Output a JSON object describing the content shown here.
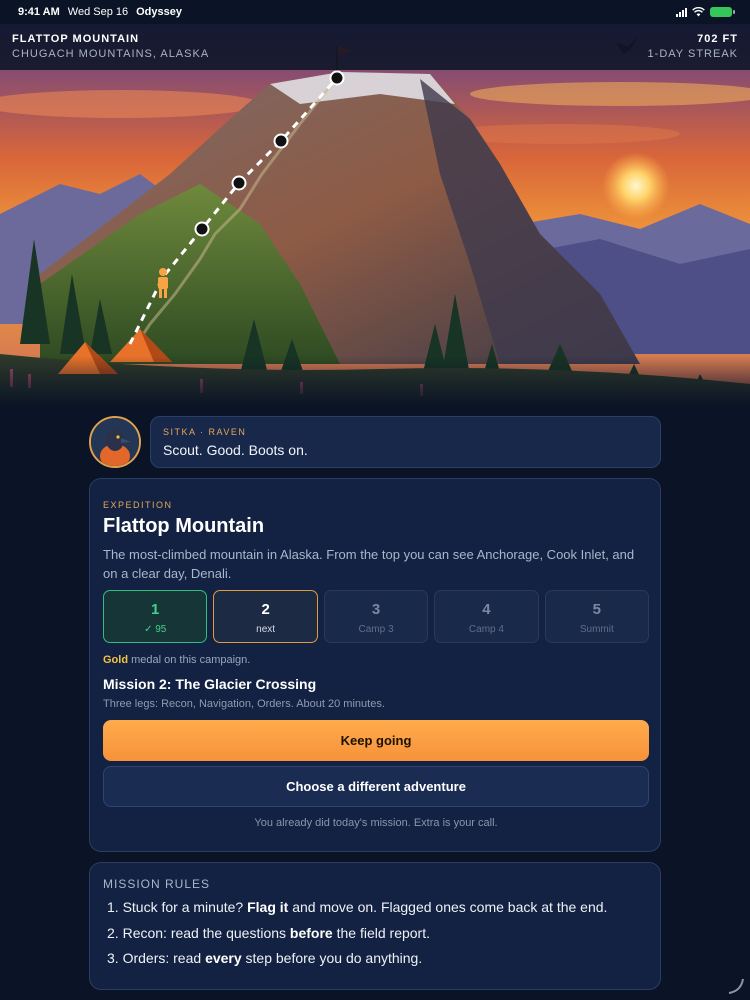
{
  "status_bar": {
    "time": "9:41 AM",
    "date": "Wed Sep 16",
    "app": "Odyssey"
  },
  "header": {
    "title": "FLATTOP MOUNTAIN",
    "subtitle": "CHUGACH MOUNTAINS, ALASKA",
    "elevation": "702 FT",
    "streak": "1-DAY STREAK"
  },
  "guide": {
    "who": "SITKA · RAVEN",
    "message": "Scout. Good. Boots on."
  },
  "expedition": {
    "eyebrow": "EXPEDITION",
    "title": "Flattop Mountain",
    "description": "The most-climbed mountain in Alaska. From the top you can see Anchorage, Cook Inlet, and on a clear day, Denali.",
    "steps": [
      {
        "num": "1",
        "sub": "✓ 95",
        "state": "done"
      },
      {
        "num": "2",
        "sub": "next",
        "state": "current"
      },
      {
        "num": "3",
        "sub": "Camp 3",
        "state": "locked"
      },
      {
        "num": "4",
        "sub": "Camp 4",
        "state": "locked"
      },
      {
        "num": "5",
        "sub": "Summit",
        "state": "locked"
      }
    ],
    "medal_word": "Gold",
    "medal_rest": " medal on this campaign.",
    "mission_title": "Mission 2: The Glacier Crossing",
    "mission_desc": "Three legs: Recon, Navigation, Orders. About 20 minutes.",
    "primary_button": "Keep going",
    "secondary_button": "Choose a different adventure",
    "note": "You already did today's mission. Extra is your call."
  },
  "rules": {
    "title": "MISSION RULES",
    "items": [
      {
        "n": "1.",
        "a": " Stuck for a minute? ",
        "b": "Flag it",
        "c": " and move on. Flagged ones come back at the end."
      },
      {
        "n": "2.",
        "a": " Recon: read the questions ",
        "b": "before",
        "c": " the field report."
      },
      {
        "n": "3.",
        "a": " Orders: read ",
        "b": "every",
        "c": " step before you do anything."
      }
    ]
  },
  "colors": {
    "accent": "#f7923a",
    "done": "#2fbf7f",
    "gold": "#f3c242",
    "background": "#0b1426"
  }
}
